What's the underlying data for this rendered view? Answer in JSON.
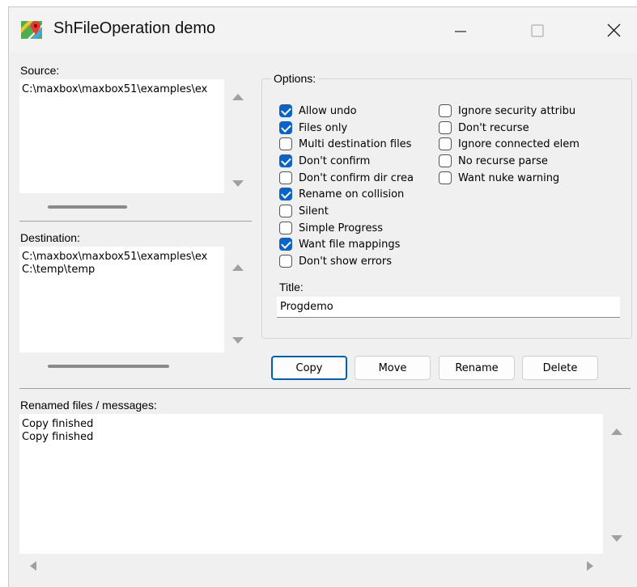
{
  "window": {
    "title": "ShFileOperation demo",
    "icon": "map-app-icon",
    "controls": {
      "minimize": "minimize-icon",
      "maximize": "maximize-icon",
      "close": "close-icon"
    }
  },
  "source": {
    "label": "Source:",
    "lines": "C:\\maxbox\\maxbox51\\examples\\ex"
  },
  "destination": {
    "label": "Destination:",
    "lines": "C:\\maxbox\\maxbox51\\examples\\ex\nC:\\temp\\temp"
  },
  "options": {
    "label": "Options:",
    "col1": [
      {
        "label": "Allow undo",
        "checked": true
      },
      {
        "label": "Files only",
        "checked": true
      },
      {
        "label": "Multi destination files",
        "checked": false
      },
      {
        "label": "Don't confirm",
        "checked": true
      },
      {
        "label": "Don't confirm dir crea",
        "checked": false
      },
      {
        "label": "Rename on collision",
        "checked": true
      },
      {
        "label": "Silent",
        "checked": false
      },
      {
        "label": "Simple Progress",
        "checked": false
      },
      {
        "label": "Want file mappings",
        "checked": true
      },
      {
        "label": "Don't show errors",
        "checked": false
      }
    ],
    "col2": [
      {
        "label": "Ignore security attribu",
        "checked": false
      },
      {
        "label": "Don't recurse",
        "checked": false
      },
      {
        "label": "Ignore connected elem",
        "checked": false
      },
      {
        "label": "No recurse parse",
        "checked": false
      },
      {
        "label": "Want nuke warning",
        "checked": false
      }
    ],
    "title_label": "Title:",
    "title_value": "Progdemo"
  },
  "buttons": {
    "copy": "Copy",
    "move": "Move",
    "rename": "Rename",
    "delete": "Delete"
  },
  "messages": {
    "label": "Renamed files / messages:",
    "lines": "Copy finished\nCopy finished"
  },
  "colors": {
    "accent": "#0a64c8",
    "default_button_border": "#005fb8"
  }
}
